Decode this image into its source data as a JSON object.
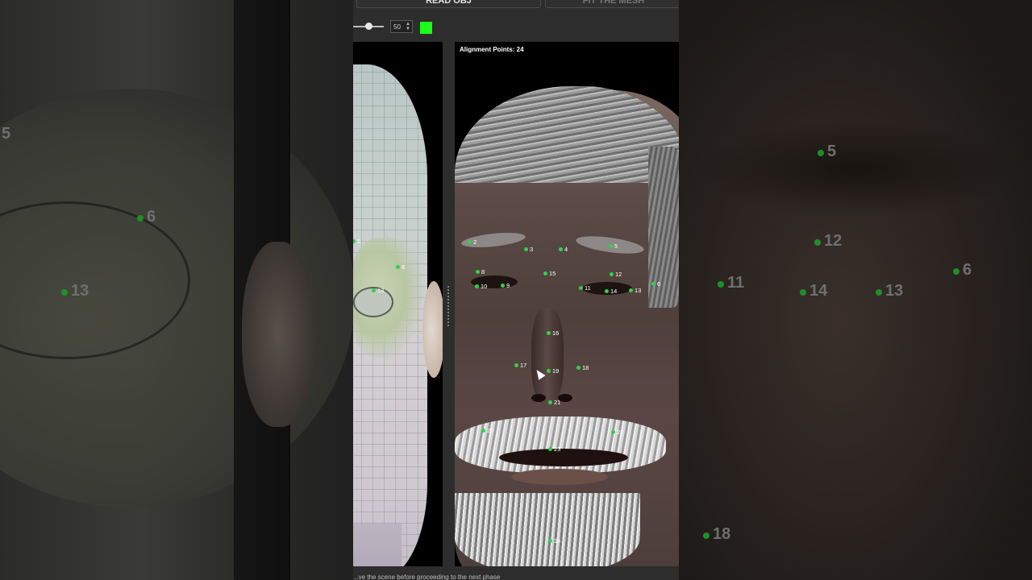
{
  "toolbar": {
    "primary_button_label": "READ OBJ",
    "secondary_button_label": "FIT THE MESH",
    "slider_value": "50",
    "point_color": "#1aff1a"
  },
  "left_view": {
    "markers": [
      {
        "id": "5",
        "label": "5"
      },
      {
        "id": "6",
        "label": "6"
      },
      {
        "id": "13",
        "label": "13"
      }
    ]
  },
  "right_view": {
    "title": "Alignment Points: 24",
    "markers": [
      "2",
      "3",
      "4",
      "5",
      "6",
      "8",
      "9",
      "10",
      "11",
      "12",
      "13",
      "14",
      "15",
      "16",
      "17",
      "18",
      "19",
      "20",
      "21",
      "22",
      "23",
      "24"
    ]
  },
  "background_zoom": {
    "left_labels": [
      "5",
      "6",
      "13"
    ],
    "right_labels": [
      "5",
      "12",
      "11",
      "14",
      "13",
      "6",
      "18"
    ]
  },
  "status": {
    "text": "...ve the scene before proceeding to the next phase"
  }
}
